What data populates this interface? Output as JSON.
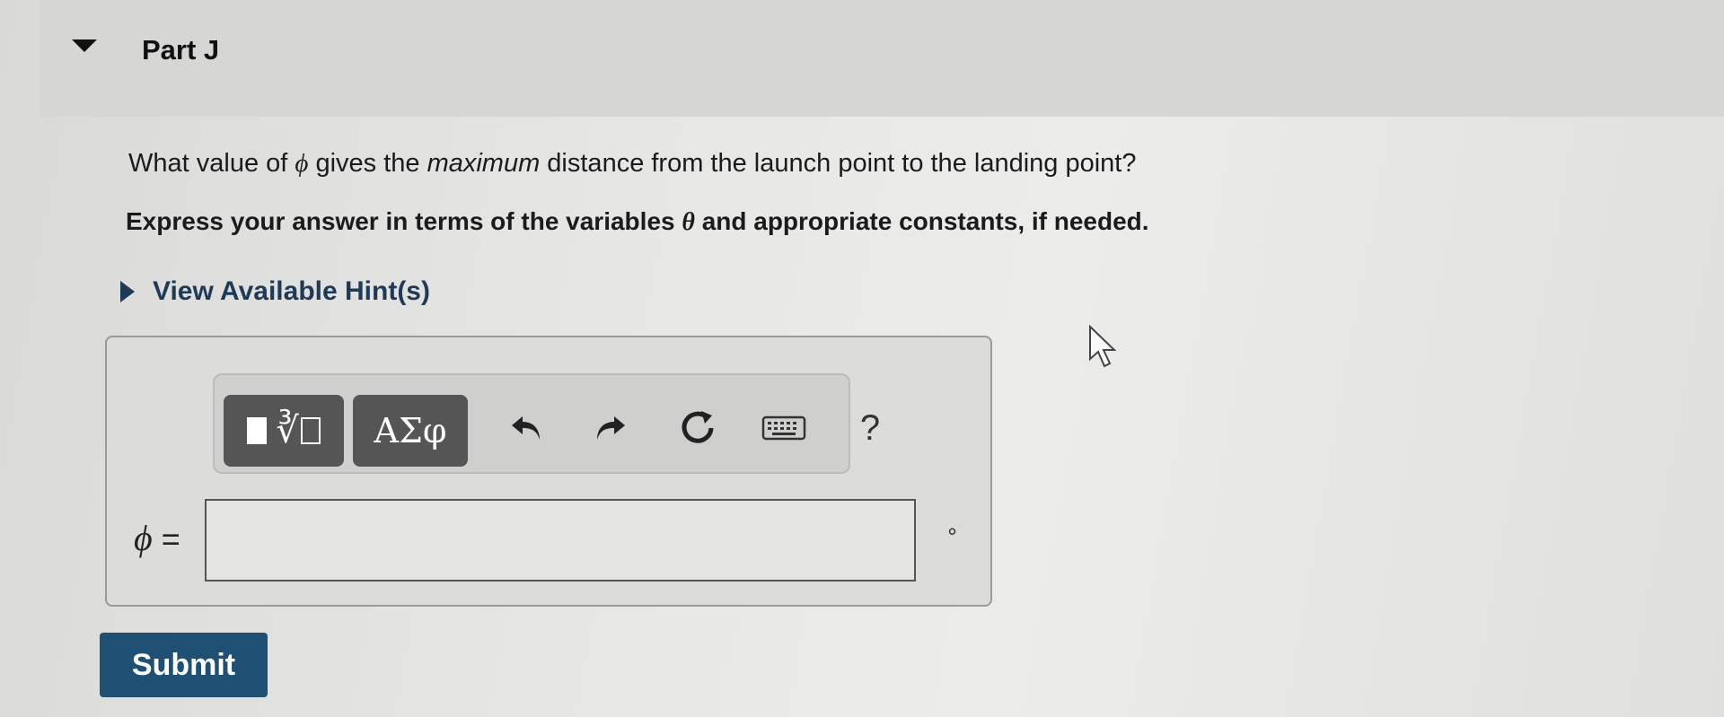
{
  "part": {
    "title": "Part J"
  },
  "question": {
    "before": "What value of ",
    "symbol": "ϕ",
    "middle": " gives the ",
    "emphasis": "maximum",
    "after": " distance from the launch point to the landing point?"
  },
  "instruction": {
    "before": "Express your answer in terms of the variables ",
    "symbol": "θ",
    "after": " and appropriate constants, if needed."
  },
  "hint": {
    "label": "View Available Hint(s)"
  },
  "toolbar": {
    "templates_icon": "templates-icon",
    "greek_label": "ΑΣφ",
    "undo_icon": "undo-icon",
    "redo_icon": "redo-icon",
    "reset_icon": "reset-icon",
    "keyboard_icon": "keyboard-icon",
    "help_label": "?"
  },
  "answer": {
    "symbol": "ϕ",
    "equals": " =",
    "value": "",
    "unit": "∘"
  },
  "submit": {
    "label": "Submit"
  },
  "colors": {
    "submit_bg": "#1f4f72",
    "hint_text": "#1f3a57",
    "toolbar_button": "#555555"
  }
}
